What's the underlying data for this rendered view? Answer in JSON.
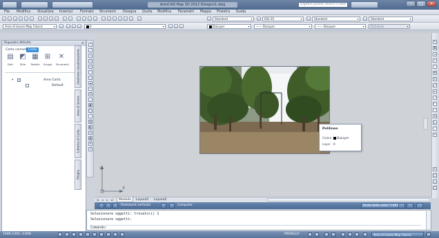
{
  "titlebar": {
    "title": "AutoCAD Map 3D 2012  Disegno1.dwg",
    "help_placeholder": "Digitare parola chiave o frase"
  },
  "menubar": {
    "items": [
      "File",
      "Modifica",
      "Visualizza",
      "Inserisci",
      "Formato",
      "Strumenti",
      "Disegna",
      "Quota",
      "Modifica",
      "Parametri",
      "Mappa",
      "Finestra",
      "Guida"
    ]
  },
  "toolbar_styles": {
    "text_style": "Standard",
    "dim_style": "ISO-25",
    "table_style": "Standard",
    "multileader_style": "Standard"
  },
  "toolbar_layers": {
    "workspace": "Area di lavoro Map Classic",
    "layer": "0",
    "color": "DaLayer",
    "linetype": "DaLayer",
    "lineweight": "DaLayer",
    "plotstyle": "DaColore"
  },
  "palette": {
    "title": "Riquadro Attività",
    "current_map_label": "Carta corrente:",
    "current_map_value": "Carta",
    "tools": [
      {
        "icon": "data-icon",
        "label": "Dati"
      },
      {
        "icon": "style-icon",
        "label": "Stile"
      },
      {
        "icon": "table-icon",
        "label": "Tabella"
      },
      {
        "icon": "groups-icon",
        "label": "Gruppi"
      },
      {
        "icon": "tools-icon",
        "label": "Strumenti"
      }
    ],
    "tree_root": "Area Carta",
    "tree_child": "Default",
    "tabs": [
      "Gestione visualizzazione",
      "Area di lavoro",
      "Libreria di Carte",
      "Sfoglia"
    ]
  },
  "tooltip": {
    "title": "Polilinea",
    "color_label": "Colore",
    "color_value": "DaLayer",
    "layer_label": "Layer",
    "layer_value": "0"
  },
  "ucs": {
    "x_label": "X",
    "y_label": "Y"
  },
  "layout_tabs": [
    "Modello",
    "Layout1",
    "Layout2"
  ],
  "viewstrip": {
    "projection_label": "Proiezione verticale",
    "computer_label": "Computer",
    "scale_label": "Scala della vista: 1:461.67"
  },
  "cmdline": {
    "lines": [
      "Selezionare oggetti: trovato(i) 1",
      "Selezionare oggetti:"
    ],
    "prompt": "Comando:"
  },
  "statusbar": {
    "coords": "1586.1302, 3.668",
    "model_label": "MODELLO",
    "workspace_label": "Area di lavoro Map Classic"
  }
}
